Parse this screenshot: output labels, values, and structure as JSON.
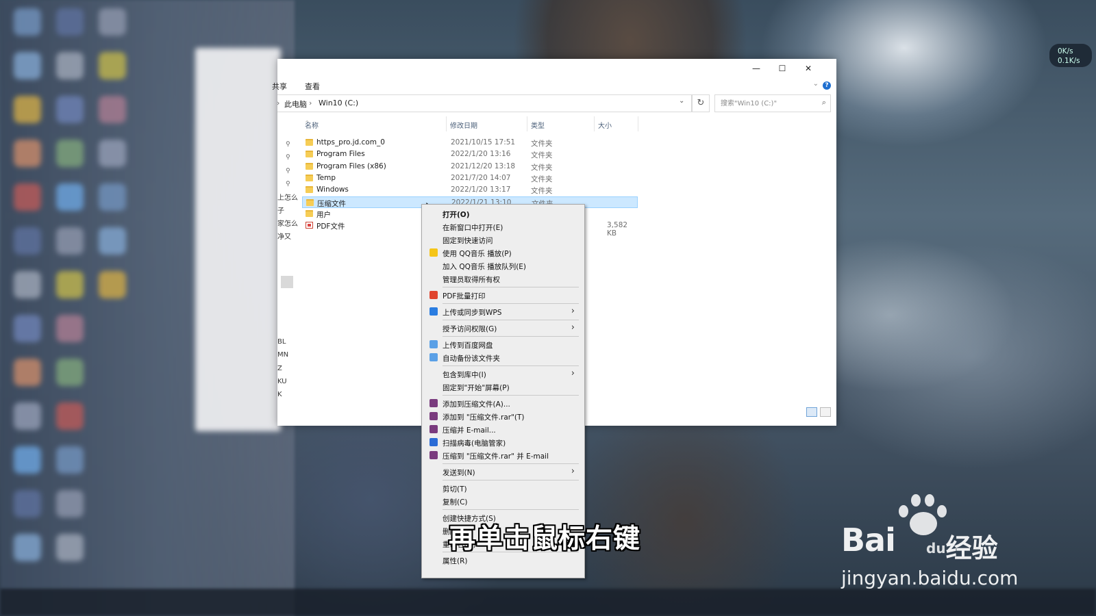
{
  "explorer": {
    "ribbon": {
      "share_tab": "共享",
      "view_tab": "查看",
      "help": "?"
    },
    "window_controls": {
      "minimize": "—",
      "maximize": "☐",
      "close": "✕"
    },
    "address": {
      "this_pc": "此电脑",
      "drive": "Win10 (C:)",
      "separator": "›"
    },
    "search": {
      "placeholder": "搜索\"Win10 (C:)\""
    },
    "columns": {
      "name": "名称",
      "date": "修改日期",
      "type": "类型",
      "size": "大小"
    },
    "rows": [
      {
        "name": "https_pro.jd.com_0",
        "date": "2021/10/15 17:51",
        "type": "文件夹",
        "size": "",
        "icon": "folder-icon"
      },
      {
        "name": "Program Files",
        "date": "2022/1/20 13:16",
        "type": "文件夹",
        "size": "",
        "icon": "folder-icon"
      },
      {
        "name": "Program Files (x86)",
        "date": "2021/12/20 13:18",
        "type": "文件夹",
        "size": "",
        "icon": "folder-icon"
      },
      {
        "name": "Temp",
        "date": "2021/7/20 14:07",
        "type": "文件夹",
        "size": "",
        "icon": "folder-icon"
      },
      {
        "name": "Windows",
        "date": "2022/1/20 13:17",
        "type": "文件夹",
        "size": "",
        "icon": "folder-icon"
      },
      {
        "name": "压缩文件",
        "date": "2022/1/21 13:10",
        "type": "文件夹",
        "size": "",
        "icon": "folder-icon",
        "selected": true
      },
      {
        "name": "用户",
        "date": "",
        "type": "",
        "size": "",
        "icon": "folder-icon"
      },
      {
        "name": "PDF文件",
        "date": "",
        "type": "",
        "size": "3,582 KB",
        "icon": "pdf-icon"
      }
    ],
    "nav_fragments": [
      "上怎么",
      "子",
      "家怎么",
      "净又",
      "BL",
      "MN",
      "Z",
      "KU",
      "K"
    ]
  },
  "net_widget": {
    "up": "0K/s",
    "down": "0.1K/s"
  },
  "context_menu": {
    "items": [
      {
        "label": "打开(O)",
        "bold": true
      },
      {
        "label": "在新窗口中打开(E)"
      },
      {
        "label": "固定到快速访问"
      },
      {
        "label": "使用 QQ音乐 播放(P)",
        "icon": "qq-music-icon"
      },
      {
        "label": "加入 QQ音乐 播放队列(E)"
      },
      {
        "label": "管理员取得所有权"
      },
      {
        "sep": true
      },
      {
        "label": "PDF批量打印",
        "icon": "wps-icon"
      },
      {
        "sep": true
      },
      {
        "label": "上传或同步到WPS",
        "icon": "wps-cloud-icon",
        "submenu": true
      },
      {
        "sep": true
      },
      {
        "label": "授予访问权限(G)",
        "submenu": true
      },
      {
        "sep": true
      },
      {
        "label": "上传到百度网盘",
        "icon": "baidu-netdisk-icon"
      },
      {
        "label": "自动备份该文件夹",
        "icon": "baidu-netdisk-icon"
      },
      {
        "sep": true
      },
      {
        "label": "包含到库中(I)",
        "submenu": true
      },
      {
        "label": "固定到\"开始\"屏幕(P)"
      },
      {
        "sep": true
      },
      {
        "label": "添加到压缩文件(A)...",
        "icon": "winrar-icon"
      },
      {
        "label": "添加到 \"压缩文件.rar\"(T)",
        "icon": "winrar-icon"
      },
      {
        "label": "压缩并 E-mail...",
        "icon": "winrar-icon"
      },
      {
        "label": "扫描病毒(电脑管家)",
        "icon": "shield-icon"
      },
      {
        "label": "压缩到 \"压缩文件.rar\" 并 E-mail",
        "icon": "winrar-icon"
      },
      {
        "sep": true
      },
      {
        "label": "发送到(N)",
        "submenu": true
      },
      {
        "sep": true
      },
      {
        "label": "剪切(T)"
      },
      {
        "label": "复制(C)"
      },
      {
        "sep": true
      },
      {
        "label": "创建快捷方式(S)"
      },
      {
        "label": "删除(D)"
      },
      {
        "label": "重命名(M)"
      },
      {
        "sep": true
      },
      {
        "label": "属性(R)"
      }
    ]
  },
  "subtitle": "再单击鼠标右键",
  "watermark": {
    "brand": "Bai",
    "paw": "du",
    "product": "经验",
    "url": "jingyan.baidu.com"
  },
  "colors": {
    "selection": "#cce8ff",
    "menu_bg": "#eeeeee",
    "accent": "#1e6fd0"
  }
}
